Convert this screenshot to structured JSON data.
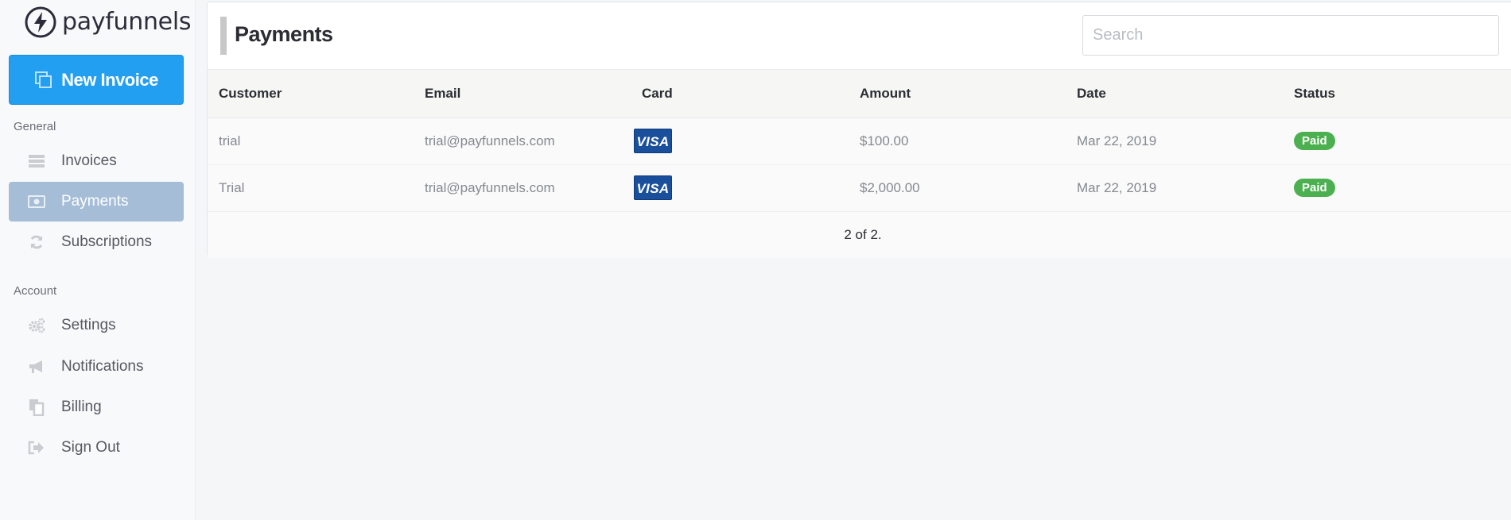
{
  "brand": {
    "name": "payfunnels",
    "logo_icon": "lightning-bolt-icon"
  },
  "sidebar": {
    "new_invoice_label": "New Invoice",
    "sections": [
      {
        "label": "General",
        "items": [
          {
            "label": "Invoices",
            "icon": "list-icon",
            "active": false
          },
          {
            "label": "Payments",
            "icon": "money-icon",
            "active": true
          },
          {
            "label": "Subscriptions",
            "icon": "refresh-icon",
            "active": false
          }
        ]
      },
      {
        "label": "Account",
        "items": [
          {
            "label": "Settings",
            "icon": "gears-icon",
            "active": false
          },
          {
            "label": "Notifications",
            "icon": "megaphone-icon",
            "active": false
          },
          {
            "label": "Billing",
            "icon": "documents-icon",
            "active": false
          },
          {
            "label": "Sign Out",
            "icon": "sign-out-icon",
            "active": false
          }
        ]
      }
    ]
  },
  "page": {
    "title": "Payments",
    "search_placeholder": "Search"
  },
  "table": {
    "headers": [
      "Customer",
      "Email",
      "Card",
      "Amount",
      "Date",
      "Status"
    ],
    "rows": [
      {
        "customer": "trial",
        "email": "trial@payfunnels.com",
        "card": "VISA",
        "amount": "$100.00",
        "date": "Mar 22, 2019",
        "status": "Paid"
      },
      {
        "customer": "Trial",
        "email": "trial@payfunnels.com",
        "card": "VISA",
        "amount": "$2,000.00",
        "date": "Mar 22, 2019",
        "status": "Paid"
      }
    ],
    "pagination": "2 of 2."
  },
  "colors": {
    "primary": "#229ff1",
    "active_nav": "#a6bdd7",
    "paid_badge": "#4caf50",
    "visa_blue": "#1a4f9c"
  }
}
